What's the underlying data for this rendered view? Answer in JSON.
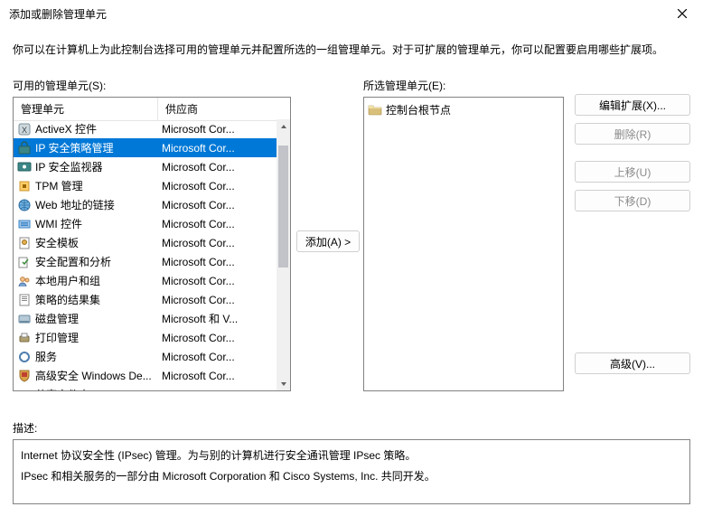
{
  "window": {
    "title": "添加或删除管理单元"
  },
  "intro": "你可以在计算机上为此控制台选择可用的管理单元并配置所选的一组管理单元。对于可扩展的管理单元，你可以配置要启用哪些扩展项。",
  "available": {
    "label": "可用的管理单元(S):",
    "columns": {
      "name": "管理单元",
      "vendor": "供应商"
    },
    "items": [
      {
        "name": "ActiveX 控件",
        "vendor": "Microsoft Cor...",
        "icon": "ax",
        "selected": false
      },
      {
        "name": "IP 安全策略管理",
        "vendor": "Microsoft Cor...",
        "icon": "ipsec",
        "selected": true
      },
      {
        "name": "IP 安全监视器",
        "vendor": "Microsoft Cor...",
        "icon": "ipsecmon",
        "selected": false
      },
      {
        "name": "TPM 管理",
        "vendor": "Microsoft Cor...",
        "icon": "tpm",
        "selected": false
      },
      {
        "name": "Web 地址的链接",
        "vendor": "Microsoft Cor...",
        "icon": "web",
        "selected": false
      },
      {
        "name": "WMI 控件",
        "vendor": "Microsoft Cor...",
        "icon": "wmi",
        "selected": false
      },
      {
        "name": "安全模板",
        "vendor": "Microsoft Cor...",
        "icon": "sectpl",
        "selected": false
      },
      {
        "name": "安全配置和分析",
        "vendor": "Microsoft Cor...",
        "icon": "seccfg",
        "selected": false
      },
      {
        "name": "本地用户和组",
        "vendor": "Microsoft Cor...",
        "icon": "users",
        "selected": false
      },
      {
        "name": "策略的结果集",
        "vendor": "Microsoft Cor...",
        "icon": "rsop",
        "selected": false
      },
      {
        "name": "磁盘管理",
        "vendor": "Microsoft 和 V...",
        "icon": "disk",
        "selected": false
      },
      {
        "name": "打印管理",
        "vendor": "Microsoft Cor...",
        "icon": "print",
        "selected": false
      },
      {
        "name": "服务",
        "vendor": "Microsoft Cor...",
        "icon": "svc",
        "selected": false
      },
      {
        "name": "高级安全 Windows De...",
        "vendor": "Microsoft Cor...",
        "icon": "wf",
        "selected": false
      },
      {
        "name": "共享文件夹",
        "vendor": "Microsoft Cor...",
        "icon": "share",
        "selected": false
      }
    ],
    "scroll": {
      "thumb_top_pct": 5,
      "thumb_height_pct": 50
    }
  },
  "add_button": "添加(A) >",
  "selected": {
    "label": "所选管理单元(E):",
    "root": "控制台根节点"
  },
  "buttons": {
    "edit_ext": "编辑扩展(X)...",
    "remove": "删除(R)",
    "move_up": "上移(U)",
    "move_down": "下移(D)",
    "advanced": "高级(V)..."
  },
  "description": {
    "label": "描述:",
    "line1": "Internet 协议安全性 (IPsec) 管理。为与别的计算机进行安全通讯管理 IPsec 策略。",
    "line2": "IPsec 和相关服务的一部分由 Microsoft Corporation 和 Cisco Systems, Inc. 共同开发。"
  }
}
